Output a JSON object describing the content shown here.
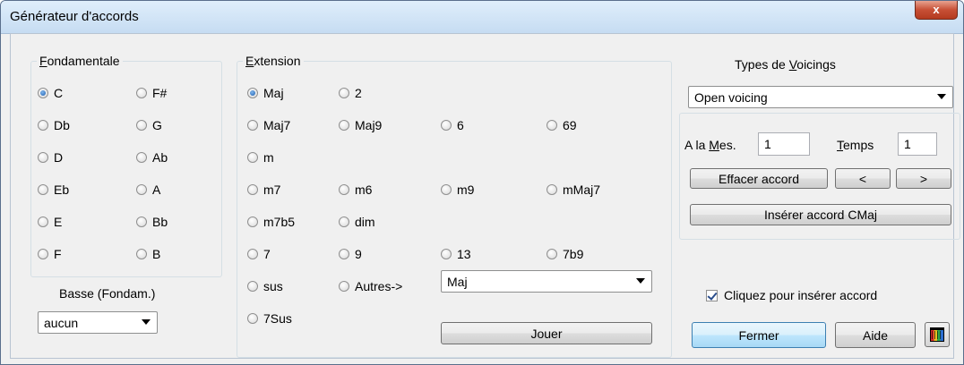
{
  "window": {
    "title": "Générateur d'accords",
    "close_label": "x"
  },
  "fondamentale": {
    "legend_u": "F",
    "legend_rest": "ondamentale",
    "left": [
      "C",
      "Db",
      "D",
      "Eb",
      "E",
      "F"
    ],
    "right": [
      "F#",
      "G",
      "Ab",
      "A",
      "Bb",
      "B"
    ],
    "selected": "C"
  },
  "basse": {
    "label": "Basse (Fondam.)",
    "value": "aucun"
  },
  "extension": {
    "legend_u": "E",
    "legend_rest": "xtension",
    "rows": [
      [
        "Maj",
        "2"
      ],
      [
        "Maj7",
        "Maj9",
        "6",
        "69"
      ],
      [
        "m"
      ],
      [
        "m7",
        "m6",
        "m9",
        "mMaj7"
      ],
      [
        "m7b5",
        "dim"
      ],
      [
        "7",
        "9",
        "13",
        "7b9"
      ],
      [
        "sus",
        "Autres->"
      ],
      [
        "7Sus"
      ]
    ],
    "selected": "Maj",
    "other_select": "Maj",
    "play_label": "Jouer"
  },
  "voicing": {
    "title_pre": "Types de ",
    "title_u": "V",
    "title_post": "oicings",
    "value": "Open voicing"
  },
  "position": {
    "mes_pre": "A la ",
    "mes_u": "M",
    "mes_post": "es.",
    "mes_value": "1",
    "temps_u": "T",
    "temps_post": "emps",
    "temps_value": "1"
  },
  "actions": {
    "clear_label": "Effacer accord",
    "prev_label": "<",
    "next_label": ">",
    "insert_label": "Insérer accord CMaj",
    "checkbox_label": "Cliquez pour insérer accord",
    "checkbox_checked": true,
    "close_label": "Fermer",
    "help_label": "Aide"
  },
  "colors": {
    "accent": "#1d5fb0",
    "close_red": "#c75036",
    "title_bg": "#c6dcf2"
  }
}
